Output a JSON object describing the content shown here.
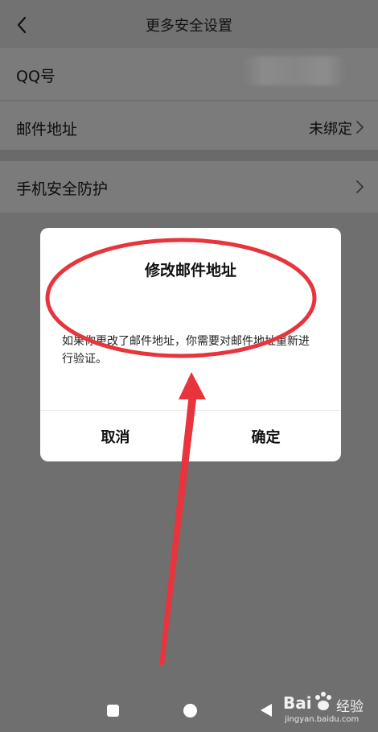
{
  "header": {
    "title": "更多安全设置"
  },
  "rows": [
    {
      "label": "QQ号",
      "value": ""
    },
    {
      "label": "邮件地址",
      "value": "未绑定"
    },
    {
      "label": "手机安全防护",
      "value": ""
    }
  ],
  "dialog": {
    "title": "修改邮件地址",
    "message": "如果你更改了邮件地址，你需要对邮件地址重新进行验证。",
    "cancel_label": "取消",
    "confirm_label": "确定"
  },
  "annotation": {
    "color": "#e8343d"
  },
  "watermark": {
    "brand_prefix": "Bai",
    "brand_suffix": "经验",
    "url": "jingyan.baidu.com"
  }
}
